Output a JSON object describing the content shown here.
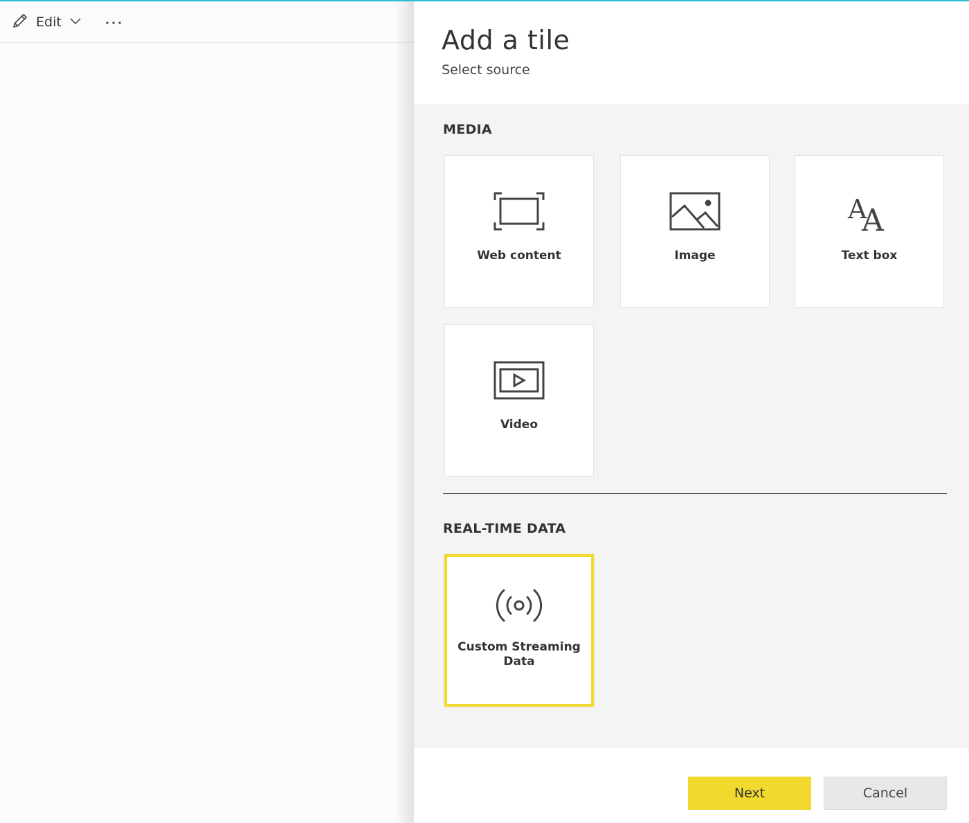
{
  "toolbar": {
    "edit_label": "Edit",
    "edit_icon": "pencil-icon",
    "dropdown_icon": "chevron-down-icon",
    "more_icon": "more-icon"
  },
  "panel": {
    "title": "Add a tile",
    "subtitle": "Select source"
  },
  "sections": {
    "media": {
      "title": "MEDIA",
      "tiles": [
        {
          "label": "Web content",
          "icon": "web-content-icon"
        },
        {
          "label": "Image",
          "icon": "image-icon"
        },
        {
          "label": "Text box",
          "icon": "text-box-icon"
        },
        {
          "label": "Video",
          "icon": "video-icon"
        }
      ]
    },
    "realtime": {
      "title": "REAL-TIME DATA",
      "tiles": [
        {
          "label": "Custom Streaming Data",
          "icon": "streaming-icon",
          "selected": true
        }
      ]
    }
  },
  "footer": {
    "next_label": "Next",
    "cancel_label": "Cancel"
  },
  "colors": {
    "accent": "#f2d92e",
    "top_bar": "#2bbcd4"
  }
}
